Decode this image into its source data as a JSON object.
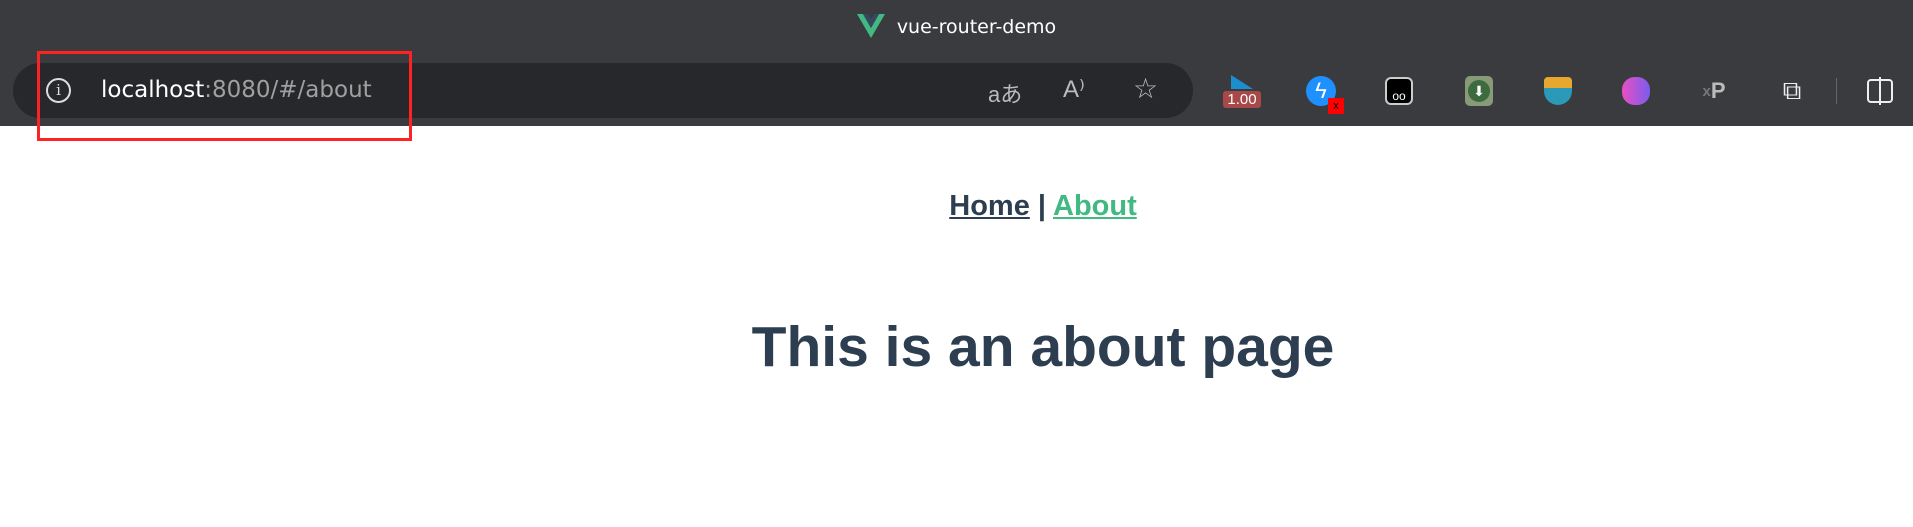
{
  "window": {
    "title": "vue-router-demo"
  },
  "address_bar": {
    "host": "localhost",
    "rest": ":8080/#/about"
  },
  "extensions": {
    "speed_badge": "1.00"
  },
  "nav": {
    "links": [
      {
        "label": "Home"
      },
      {
        "label": "About"
      }
    ],
    "separator": "|"
  },
  "main": {
    "heading": "This is an about page"
  },
  "colors": {
    "accent": "#42b983",
    "text": "#2c3e50",
    "highlight_box": "#ff2222"
  }
}
